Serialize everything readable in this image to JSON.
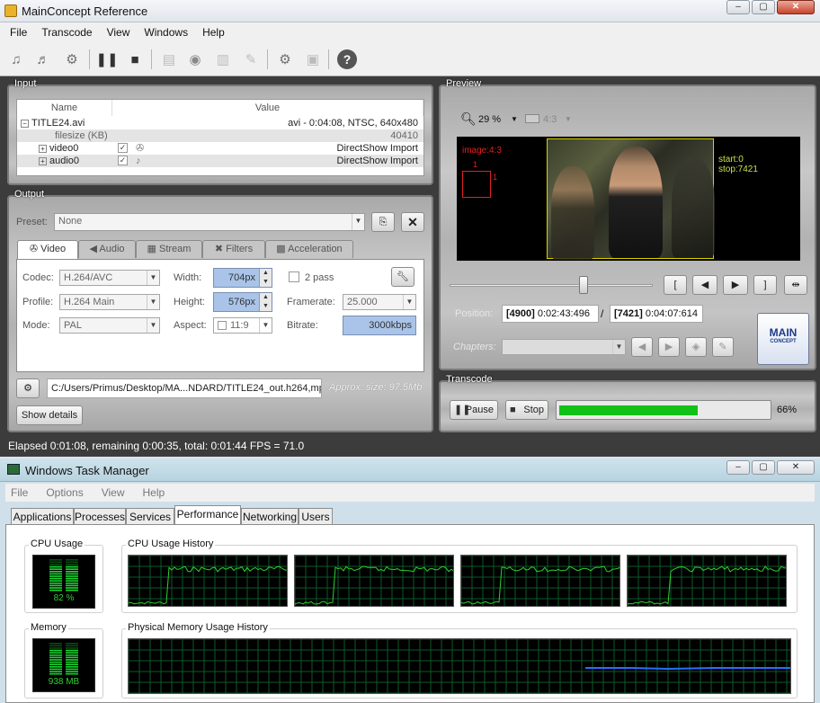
{
  "mc": {
    "title": "MainConcept Reference",
    "menu": [
      "File",
      "Transcode",
      "View",
      "Windows",
      "Help"
    ],
    "input": {
      "label": "Input",
      "col_name": "Name",
      "col_value": "Value",
      "rows": [
        {
          "name": "TITLE24.avi",
          "value": "avi - 0:04:08, NTSC, 640x480"
        },
        {
          "name": "filesize (KB)",
          "value": "40410"
        },
        {
          "name": "video0",
          "value": "DirectShow Import"
        },
        {
          "name": "audio0",
          "value": "DirectShow Import"
        }
      ]
    },
    "output": {
      "label": "Output",
      "preset_label": "Preset:",
      "preset_value": "None",
      "tabs": [
        "Video",
        "Audio",
        "Stream",
        "Filters",
        "Acceleration"
      ],
      "codec_label": "Codec:",
      "codec_value": "H.264/AVC",
      "profile_label": "Profile:",
      "profile_value": "H.264 Main",
      "mode_label": "Mode:",
      "mode_value": "PAL",
      "width_label": "Width:",
      "width_value": "704px",
      "height_label": "Height:",
      "height_value": "576px",
      "aspect_label": "Aspect:",
      "aspect_value": "11:9",
      "twopass_label": "2 pass",
      "framerate_label": "Framerate:",
      "framerate_value": "25.000",
      "bitrate_label": "Bitrate:",
      "bitrate_value": "3000kbps",
      "path": "C:/Users/Primus/Desktop/MA...NDARD/TITLE24_out.h264,mpa",
      "approx": "Approx. size: 97.5Mb",
      "show_details": "Show details"
    },
    "preview": {
      "label": "Preview",
      "zoom": "29 %",
      "aspect": "4:3",
      "image_label": "image:4:3",
      "marker_a": "1",
      "marker_b": "1",
      "start": "start:0",
      "stop": "stop:7421",
      "position_label": "Position:",
      "position_frame": "[4900]",
      "position_time": "0:02:43:496",
      "slash": "/",
      "total_frame": "[7421]",
      "total_time": "0:04:07:614",
      "chapters_label": "Chapters:",
      "slider_fraction": 0.66,
      "logo_top": "MAIN",
      "logo_bottom": "CONCEPT"
    },
    "transcode": {
      "label": "Transcode",
      "pause": "Pause",
      "stop": "Stop",
      "progress": 66,
      "progress_text": "66%"
    },
    "status": "Elapsed 0:01:08, remaining 0:00:35, total: 0:01:44 FPS =   71.0"
  },
  "tm": {
    "title": "Windows Task Manager",
    "menu": [
      "File",
      "Options",
      "View",
      "Help"
    ],
    "tabs": [
      "Applications",
      "Processes",
      "Services",
      "Performance",
      "Networking",
      "Users"
    ],
    "active_tab": "Performance",
    "cpu_usage_label": "CPU Usage",
    "cpu_usage_value": "82 %",
    "cpu_usage_percent": 82,
    "cpu_history_label": "CPU Usage History",
    "memory_label": "Memory",
    "memory_value": "938 MB",
    "mem_history_label": "Physical Memory Usage History",
    "colors": {
      "graph_line": "#2ed12e",
      "memory_line": "#2a6dff",
      "meter": "#19d630",
      "progress": "#12c118"
    }
  }
}
